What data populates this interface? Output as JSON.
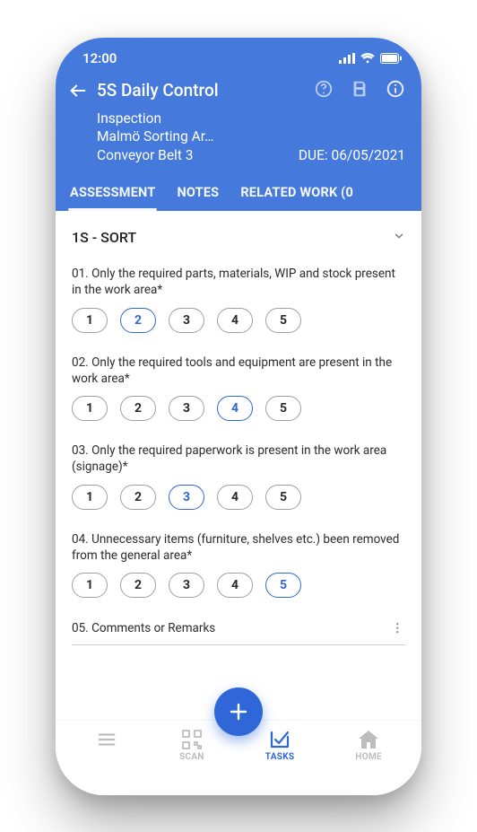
{
  "status": {
    "time": "12:00"
  },
  "colors": {
    "primary": "#4579db",
    "accent": "#2f67d8"
  },
  "header": {
    "title": "5S Daily Control",
    "type": "Inspection",
    "location": "Malmö Sorting Ar…",
    "asset": "Conveyor Belt 3",
    "due_label": "DUE: 06/05/2021"
  },
  "tabs": [
    {
      "label": "ASSESSMENT",
      "active": true
    },
    {
      "label": "NOTES",
      "active": false
    },
    {
      "label": "RELATED WORK (0",
      "active": false
    }
  ],
  "section": {
    "title": "1S - SORT"
  },
  "questions": [
    {
      "text": "01. Only the required parts, materials, WIP and stock present in the work area*",
      "options": [
        "1",
        "2",
        "3",
        "4",
        "5"
      ],
      "selected": "2"
    },
    {
      "text": "02. Only the required tools and equipment are present in the work area*",
      "options": [
        "1",
        "2",
        "3",
        "4",
        "5"
      ],
      "selected": "4"
    },
    {
      "text": "03. Only the required paperwork is present in the work area (signage)*",
      "options": [
        "1",
        "2",
        "3",
        "4",
        "5"
      ],
      "selected": "3"
    },
    {
      "text": "04. Unnecessary items (furniture, shelves etc.) been removed from the general area*",
      "options": [
        "1",
        "2",
        "3",
        "4",
        "5"
      ],
      "selected": "5"
    }
  ],
  "comments": {
    "label": "05. Comments or Remarks"
  },
  "bottom_nav": {
    "menu": "",
    "scan": "SCAN",
    "tasks": "TASKS",
    "home": "HOME"
  }
}
